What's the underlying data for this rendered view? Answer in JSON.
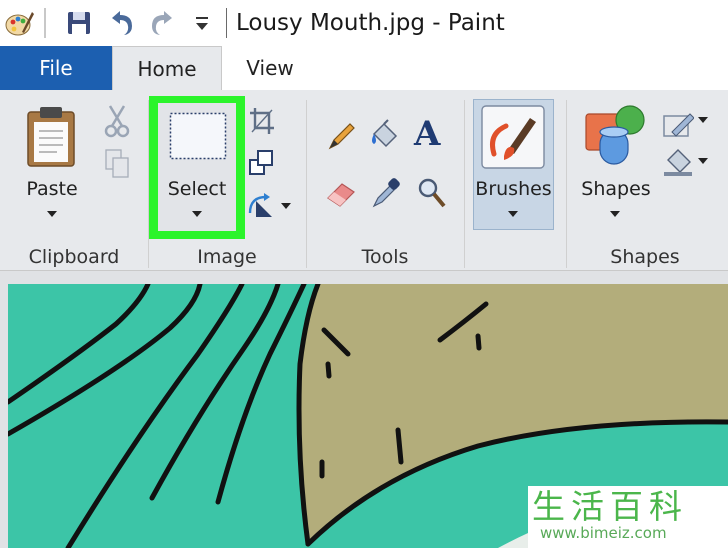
{
  "window": {
    "title": "Lousy Mouth.jpg - Paint"
  },
  "tabs": [
    {
      "label": "File"
    },
    {
      "label": "Home"
    },
    {
      "label": "View"
    }
  ],
  "ribbon": {
    "clipboard": {
      "group_label": "Clipboard",
      "paste_label": "Paste"
    },
    "image": {
      "group_label": "Image",
      "select_label": "Select"
    },
    "tools": {
      "group_label": "Tools"
    },
    "brushes": {
      "label": "Brushes"
    },
    "shapes": {
      "group_label": "Shapes",
      "shapes_label": "Shapes"
    }
  },
  "watermark": {
    "chars": "生活百科",
    "url": "www.bimeiz.com"
  },
  "colors": {
    "file_tab": "#1c5fb0",
    "select_highlight": "#2bf42b",
    "canvas_teal": "#3cc5a7",
    "canvas_khaki": "#b3ad7b",
    "watermark_green": "#4bb64b"
  }
}
